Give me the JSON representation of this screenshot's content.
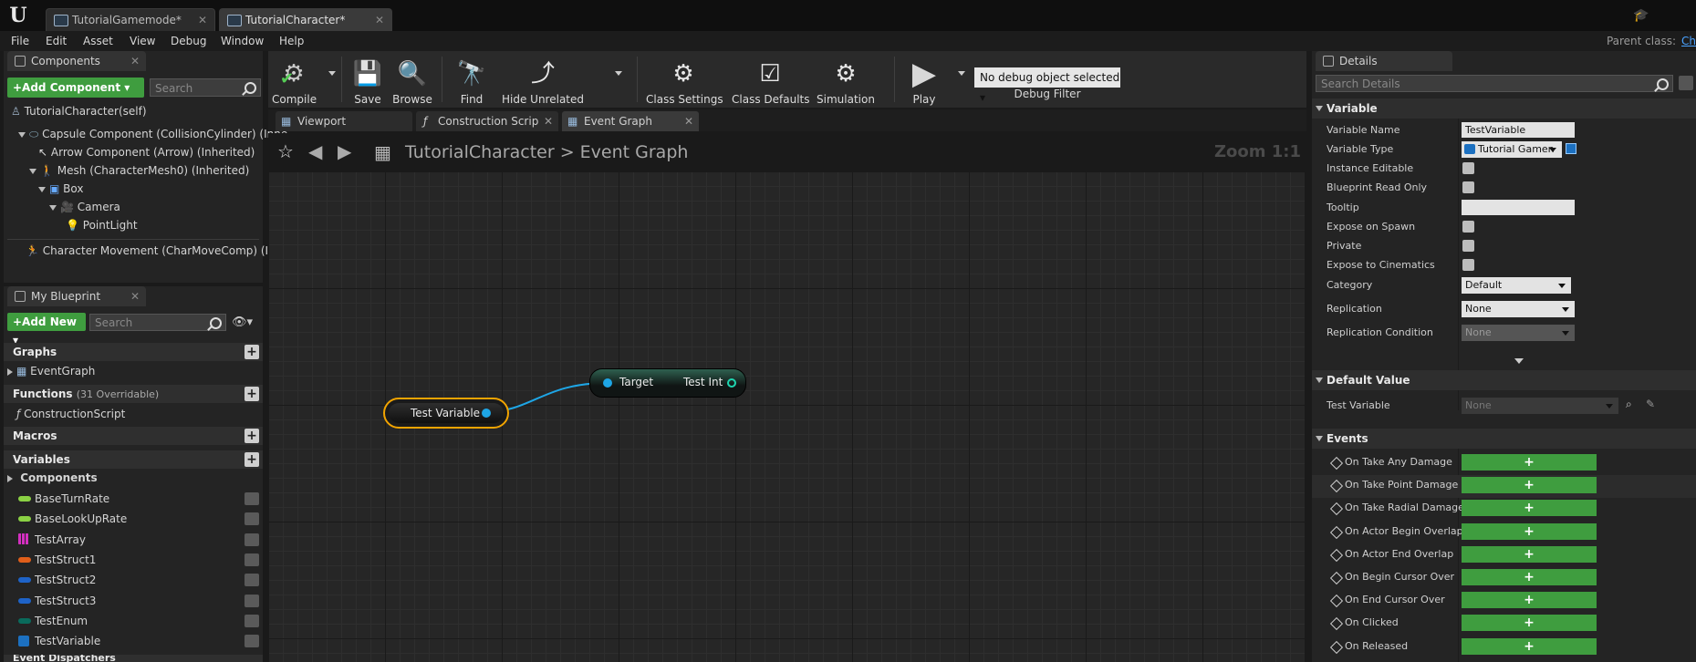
{
  "window": {
    "tabs": [
      {
        "label": "TutorialGamemode*"
      },
      {
        "label": "TutorialCharacter*"
      }
    ]
  },
  "menu": [
    "File",
    "Edit",
    "Asset",
    "View",
    "Debug",
    "Window",
    "Help"
  ],
  "parent_class": {
    "label": "Parent class:",
    "value": "Ch"
  },
  "components_panel": {
    "tab": "Components",
    "add_button": "+Add Component",
    "search_placeholder": "Search",
    "self": "TutorialCharacter(self)",
    "tree": [
      "Capsule Component (CollisionCylinder) (Inhe",
      "Arrow Component (Arrow) (Inherited)",
      "Mesh (CharacterMesh0) (Inherited)",
      "Box",
      "Camera",
      "PointLight",
      "Character Movement (CharMoveComp) (Inhe"
    ]
  },
  "my_blueprint": {
    "tab": "My Blueprint",
    "add_button": "+Add New",
    "search_placeholder": "Search",
    "graphs": "Graphs",
    "event_graph": "EventGraph",
    "functions": "Functions",
    "functions_note": "(31 Overridable)",
    "construction_script": "ConstructionScript",
    "macros": "Macros",
    "variables": "Variables",
    "components": "Components",
    "variable_list": [
      {
        "name": "BaseTurnRate",
        "color": "#8bd144"
      },
      {
        "name": "BaseLookUpRate",
        "color": "#8bd144"
      },
      {
        "name": "TestArray",
        "color": "#d42fc0"
      },
      {
        "name": "TestStruct1",
        "color": "#e05e1a"
      },
      {
        "name": "TestStruct2",
        "color": "#1e63c8"
      },
      {
        "name": "TestStruct3",
        "color": "#1e63c8"
      },
      {
        "name": "TestEnum",
        "color": "#0a6b5c"
      },
      {
        "name": "TestVariable",
        "color": "#1c70c0"
      }
    ],
    "event_dispatchers": "Event Dispatchers"
  },
  "toolbar": {
    "compile": "Compile",
    "save": "Save",
    "browse": "Browse",
    "find": "Find",
    "hide_unrelated": "Hide Unrelated",
    "class_settings": "Class Settings",
    "class_defaults": "Class Defaults",
    "simulation": "Simulation",
    "play": "Play",
    "debug_object": "No debug object selected",
    "debug_filter": "Debug Filter"
  },
  "graph_tabs": [
    "Viewport",
    "Construction Scrip",
    "Event Graph"
  ],
  "breadcrumb": {
    "root": "TutorialCharacter",
    "sep": ">",
    "current": "Event Graph"
  },
  "zoom": "Zoom 1:1",
  "nodes": {
    "get_variable": "Test Variable",
    "target_node": {
      "input": "Target",
      "output": "Test Int"
    }
  },
  "details": {
    "tab": "Details",
    "search_placeholder": "Search Details",
    "variable_cat": "Variable",
    "rows": {
      "variable_name_label": "Variable Name",
      "variable_name": "TestVariable",
      "variable_type_label": "Variable Type",
      "variable_type": "Tutorial Gamen",
      "instance_editable": "Instance Editable",
      "blueprint_read_only": "Blueprint Read Only",
      "tooltip": "Tooltip",
      "expose_on_spawn": "Expose on Spawn",
      "private": "Private",
      "expose_to_cinematics": "Expose to Cinematics",
      "category_label": "Category",
      "category": "Default",
      "replication_label": "Replication",
      "replication": "None",
      "replication_condition_label": "Replication Condition",
      "replication_condition": "None"
    },
    "default_value_cat": "Default Value",
    "default_value_label": "Test Variable",
    "default_value": "None",
    "events_cat": "Events",
    "events": [
      "On Take Any Damage",
      "On Take Point Damage",
      "On Take Radial Damage",
      "On Actor Begin Overlap",
      "On Actor End Overlap",
      "On Begin Cursor Over",
      "On End Cursor Over",
      "On Clicked",
      "On Released"
    ],
    "add_glyph": "+"
  }
}
